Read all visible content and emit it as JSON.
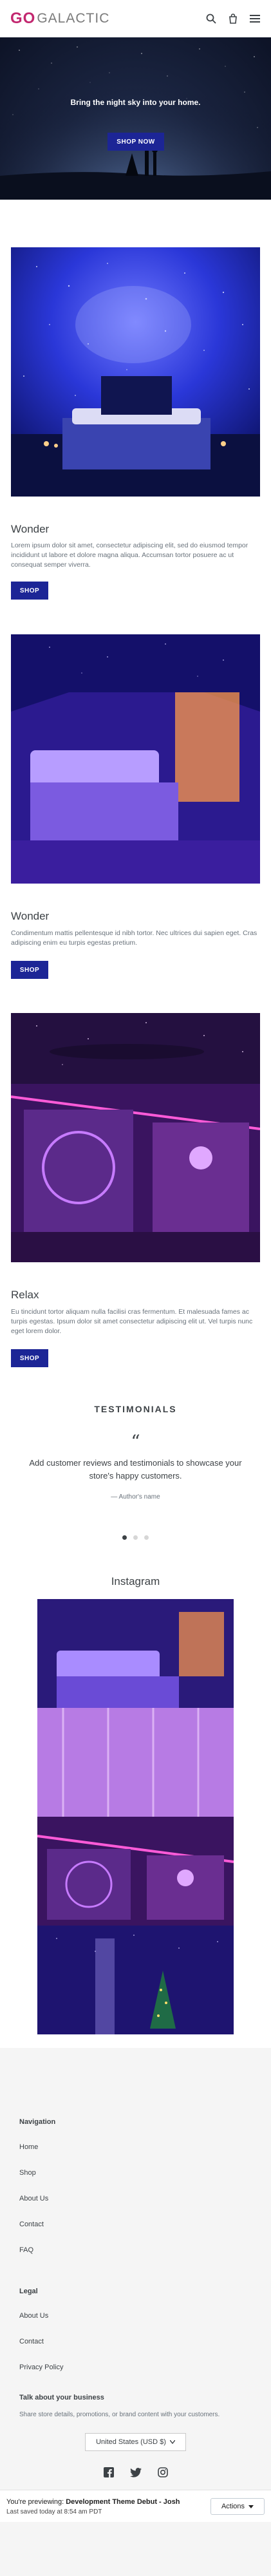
{
  "header": {
    "logo_prefix": "GO",
    "logo_suffix": "GALACTIC",
    "icons": [
      "search-icon",
      "cart-icon",
      "menu-icon"
    ]
  },
  "hero": {
    "tagline": "Bring the night sky into your home.",
    "button_label": "SHOP NOW"
  },
  "features": [
    {
      "title": "Wonder",
      "text": "Lorem ipsum dolor sit amet, consectetur adipiscing elit, sed do eiusmod tempor incididunt ut labore et dolore magna aliqua. Accumsan tortor posuere ac ut consequat semper viverra.",
      "button_label": "SHOP"
    },
    {
      "title": "Wonder",
      "text": "Condimentum mattis pellentesque id nibh tortor. Nec ultrices dui sapien eget. Cras adipiscing enim eu turpis egestas pretium.",
      "button_label": "SHOP"
    },
    {
      "title": "Relax",
      "text": "Eu tincidunt tortor aliquam nulla facilisi cras fermentum. Et malesuada fames ac turpis egestas. Ipsum dolor sit amet consectetur adipiscing elit ut. Vel turpis nunc eget lorem dolor.",
      "button_label": "SHOP"
    }
  ],
  "testimonials": {
    "heading": "TESTIMONIALS",
    "quote_mark": "“",
    "text": "Add customer reviews and testimonials to showcase your store's happy customers.",
    "author": "— Author's name",
    "slides": 3,
    "active_slide": 1
  },
  "instagram": {
    "heading": "Instagram"
  },
  "footer": {
    "navigation_heading": "Navigation",
    "navigation_links": [
      "Home",
      "Shop",
      "About Us",
      "Contact",
      "FAQ"
    ],
    "legal_heading": "Legal",
    "legal_links": [
      "About Us",
      "Contact",
      "Privacy Policy"
    ],
    "business_heading": "Talk about your business",
    "business_text": "Share store details, promotions, or brand content with your customers.",
    "currency": "United States (USD $)",
    "social_icons": [
      "facebook-icon",
      "twitter-icon",
      "instagram-icon"
    ]
  },
  "preview_bar": {
    "prefix": "You're previewing:",
    "theme_name": "Development Theme Debut - Josh",
    "saved": "Last saved today at 8:54 am PDT",
    "actions_label": "Actions"
  },
  "colors": {
    "brand_pink": "#e23a8b",
    "button_blue": "#1c2596",
    "text_dark": "#3d4246",
    "text_muted": "#69727b",
    "footer_bg": "#f5f5f5"
  }
}
